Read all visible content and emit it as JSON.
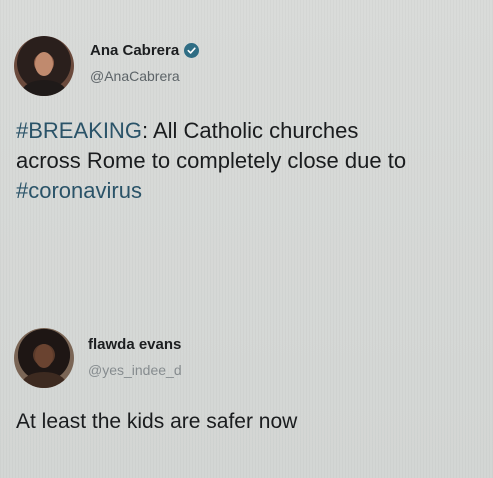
{
  "tweets": [
    {
      "author": {
        "display_name": "Ana Cabrera",
        "handle": "@AnaCabrera",
        "verified": true
      },
      "text": {
        "tag1": "#BREAKING",
        "part1": ": All Catholic churches",
        "part2": "across Rome to completely close due to",
        "tag2": "#coronavirus"
      }
    },
    {
      "author": {
        "display_name": "flawda evans",
        "handle": "@yes_indee_d",
        "verified": false
      },
      "text": {
        "line1": "At least the kids are safer now"
      }
    }
  ],
  "colors": {
    "hashtag": "#2a5368",
    "verified_badge": "#2f6d84",
    "background": "#d6d8d6"
  },
  "icons": {
    "verified": "verified-badge-icon"
  }
}
